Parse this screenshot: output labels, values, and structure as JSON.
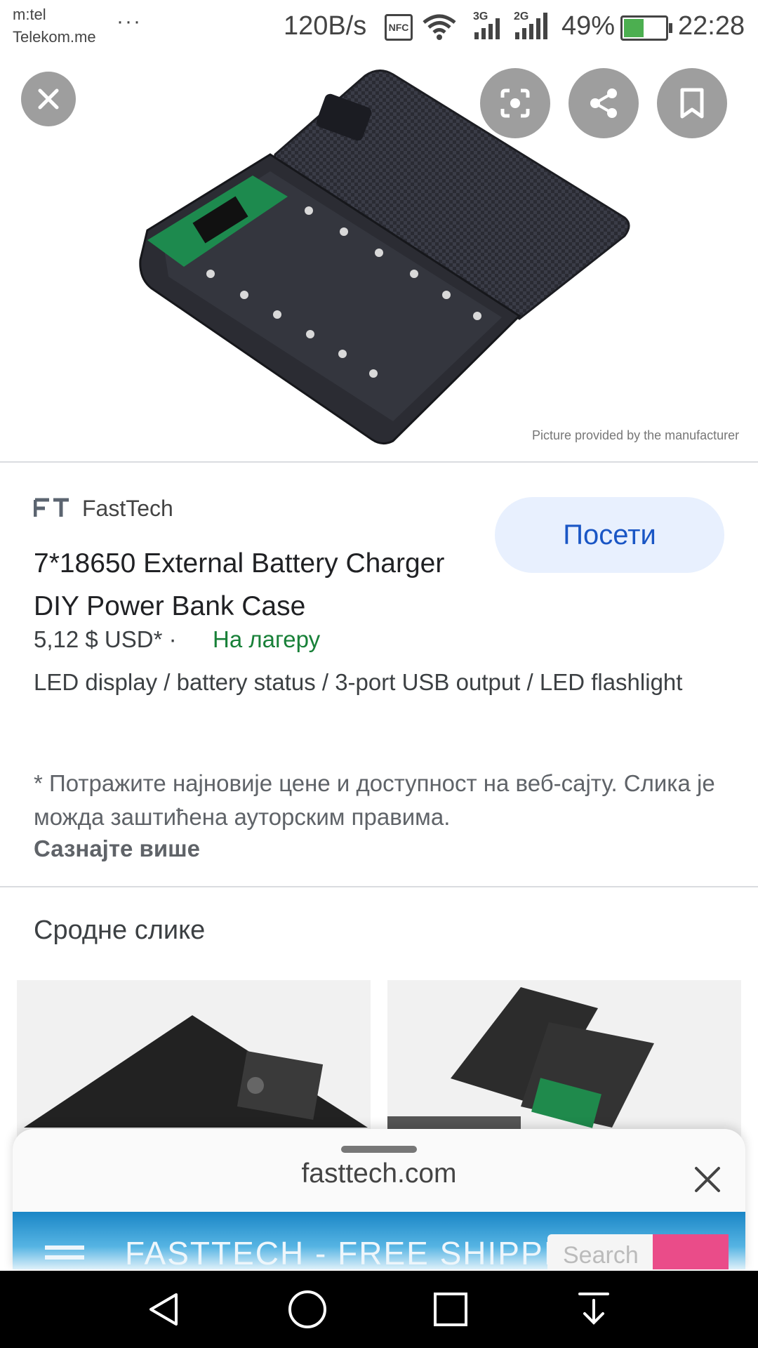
{
  "status_bar": {
    "carrier_line1": "m:tel",
    "carrier_line2": "Telekom.me",
    "more": "···",
    "speed": "120B/s",
    "nfc": "NFC",
    "net1": "3G",
    "net2": "2G",
    "battery_pct": "49%",
    "time": "22:28"
  },
  "viewer": {
    "credit": "Picture provided by the manufacturer"
  },
  "product": {
    "site": "FastTech",
    "visit_label": "Посети",
    "title": "7*18650 External Battery Charger DIY Power Bank Case",
    "price": "5,12 $ USD*  ·",
    "stock": "На лагеру",
    "description": "LED display / battery status / 3-port USB output / LED flashlight",
    "note": "* Потражите најновије цене и доступност на веб-сајту. Слика је можда заштићена ауторским правима.",
    "learn_more": "Сазнајте више"
  },
  "related": {
    "title": "Сродне слике"
  },
  "sheet": {
    "url": "fasttech.com",
    "banner_text": "FASTTECH - FREE SHIPPING",
    "search_placeholder": "Search"
  },
  "colors": {
    "visit_bg": "#e8f0fe",
    "visit_text": "#1a56c5",
    "stock_green": "#188038",
    "banner_blue": "#1a86c6"
  }
}
